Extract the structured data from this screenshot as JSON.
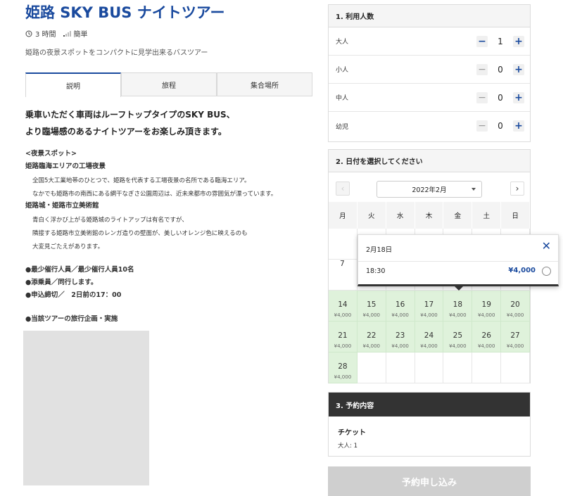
{
  "tour": {
    "title": "姫路 SKY BUS ナイトツアー",
    "duration": "3 時間",
    "difficulty": "簡単",
    "subtitle": "姫路の夜景スポットをコンパクトに見学出来るバスツアー"
  },
  "tabs": [
    "説明",
    "旅程",
    "集合場所"
  ],
  "description": {
    "lead_1": "乗車いただく車両はルーフトップタイプのSKY BUS、",
    "lead_2": "より臨場感のあるナイトツアーをお楽しみ頂きます。",
    "section_title": "<夜景スポット>",
    "spot1_title": "姫路臨海エリアの工場夜景",
    "spot1_line1": "全国5大工業地帯のひとつで、姫路を代表する工場夜景の名所である臨海エリア。",
    "spot1_line2": "なかでも姫路市の南西にある網干なぎさ公園周辺は、近未来都市の雰囲気が漂っています。",
    "spot2_title": "姫路城・姫路市立美術館",
    "spot2_line1": "青白く浮かび上がる姫路城のライトアップは有名ですが、",
    "spot2_line2": "隣接する姫路市立美術館のレンガ造りの壁面が、美しいオレンジ色に映えるのも",
    "spot2_line3": "大変見ごたえがあります。",
    "info1": "●最少催行人員／最少催行人員10名",
    "info2": "●添乗員／同行します。",
    "info3": "●申込締切／　2日前の17：00",
    "info4": "●当該ツアーの旅行企画・実施"
  },
  "passengers": {
    "heading": "1. 利用人数",
    "rows": [
      {
        "label": "大人",
        "count": "1"
      },
      {
        "label": "小人",
        "count": "0"
      },
      {
        "label": "中人",
        "count": "0"
      },
      {
        "label": "幼児",
        "count": "0"
      }
    ]
  },
  "calendar": {
    "heading": "2. 日付を選択してください",
    "month": "2022年2月",
    "weekdays": [
      "月",
      "火",
      "水",
      "木",
      "金",
      "土",
      "日"
    ],
    "visible_day": "7",
    "weeks": [
      [
        {
          "d": "14",
          "p": "¥4,000"
        },
        {
          "d": "15",
          "p": "¥4,000"
        },
        {
          "d": "16",
          "p": "¥4,000"
        },
        {
          "d": "17",
          "p": "¥4,000"
        },
        {
          "d": "18",
          "p": "¥4,000"
        },
        {
          "d": "19",
          "p": "¥4,000"
        },
        {
          "d": "20",
          "p": "¥4,000"
        }
      ],
      [
        {
          "d": "21",
          "p": "¥4,000"
        },
        {
          "d": "22",
          "p": "¥4,000"
        },
        {
          "d": "23",
          "p": "¥4,000"
        },
        {
          "d": "24",
          "p": "¥4,000"
        },
        {
          "d": "25",
          "p": "¥4,000"
        },
        {
          "d": "26",
          "p": "¥4,000"
        },
        {
          "d": "27",
          "p": "¥4,000"
        }
      ],
      [
        {
          "d": "28",
          "p": "¥4,000"
        }
      ]
    ]
  },
  "popover": {
    "date": "2月18日",
    "time": "18:30",
    "price": "¥4,000"
  },
  "reservation": {
    "heading": "3. 予約内容",
    "ticket_title": "チケット",
    "ticket_line": "大人: 1"
  },
  "submit_label": "予約申し込み"
}
